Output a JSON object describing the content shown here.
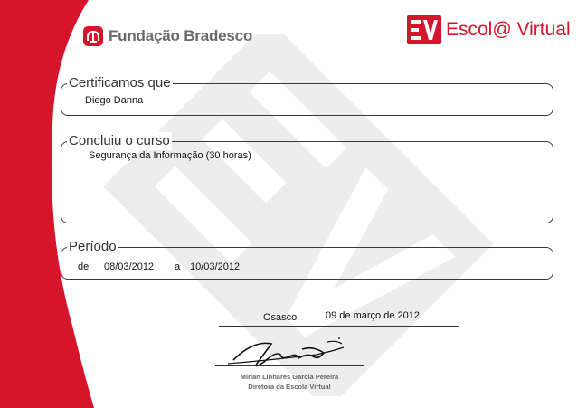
{
  "brand": {
    "left_logo_text": "Fundação Bradesco",
    "right_logo_text": "Escol@ Virtual",
    "right_logo_mark": "EV",
    "accent_color": "#d4152a"
  },
  "certificate": {
    "recipient_legend": "Certificamos que",
    "recipient_name": "Diego Danna",
    "course_legend": "Concluiu o curso",
    "course_name": "Segurança da Informação (30 horas)",
    "period_legend": "Período",
    "period_from_label": "de",
    "period_from_date": "08/03/2012",
    "period_to_label": "a",
    "period_to_date": "10/03/2012",
    "place": "Osasco",
    "issue_date": "09 de março de 2012",
    "signer_name": "Mirian Linhares Garcia Pereira",
    "signer_title": "Diretora da Escola Virtual"
  },
  "icons": {
    "left_logo_icon": "bradesco-tree-icon",
    "right_logo_icon": "ev-logo-icon",
    "watermark": "ev-watermark"
  }
}
